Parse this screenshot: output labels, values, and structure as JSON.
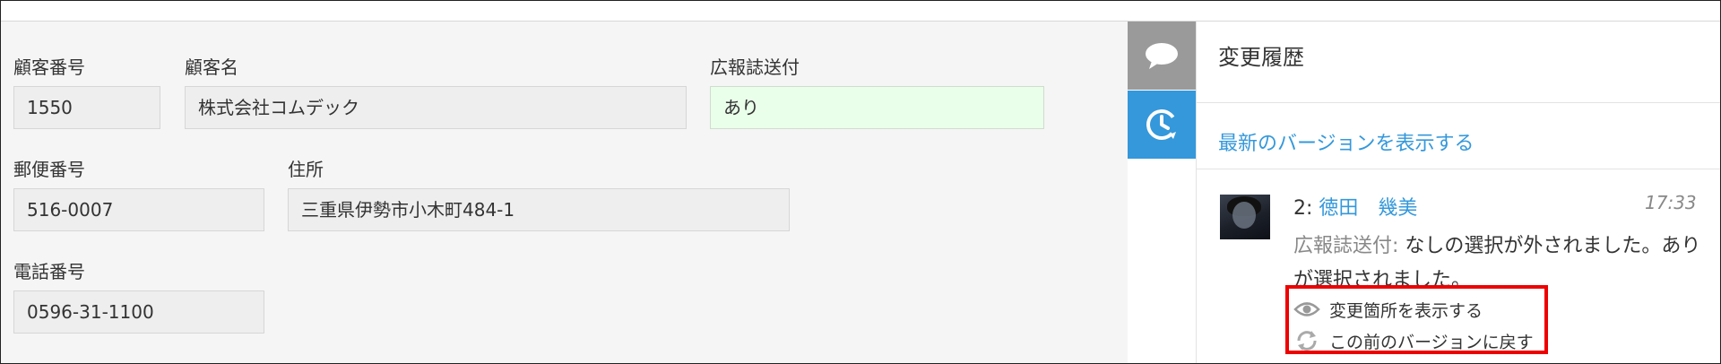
{
  "record": {
    "fields": [
      {
        "label": "顧客番号",
        "value": "1550"
      },
      {
        "label": "顧客名",
        "value": "株式会社コムデック"
      },
      {
        "label": "広報誌送付",
        "value": "あり"
      },
      {
        "label": "郵便番号",
        "value": "516-0007"
      },
      {
        "label": "住所",
        "value": "三重県伊勢市小木町484-1"
      },
      {
        "label": "電話番号",
        "value": "0596-31-1100"
      }
    ]
  },
  "tabs": [
    {
      "name": "comment",
      "icon": "speech-bubble-icon",
      "color": "#9a9a9a"
    },
    {
      "name": "history",
      "icon": "history-clock-icon",
      "color": "#3498db"
    }
  ],
  "history": {
    "title": "変更履歴",
    "latest_link": "最新のバージョンを表示する",
    "entry": {
      "version": "2:",
      "author": "徳田　幾美",
      "time": "17:33",
      "field": "広報誌送付:",
      "change": "なしの選択が外されました。ありが選択されました。",
      "actions": [
        {
          "label": "変更箇所を表示する",
          "icon": "eye-icon"
        },
        {
          "label": "この前のバージョンに戻す",
          "icon": "revert-icon"
        }
      ]
    }
  },
  "colors": {
    "link": "#3498db",
    "highlight": "#ee0000",
    "accent_tab": "#3498db"
  }
}
